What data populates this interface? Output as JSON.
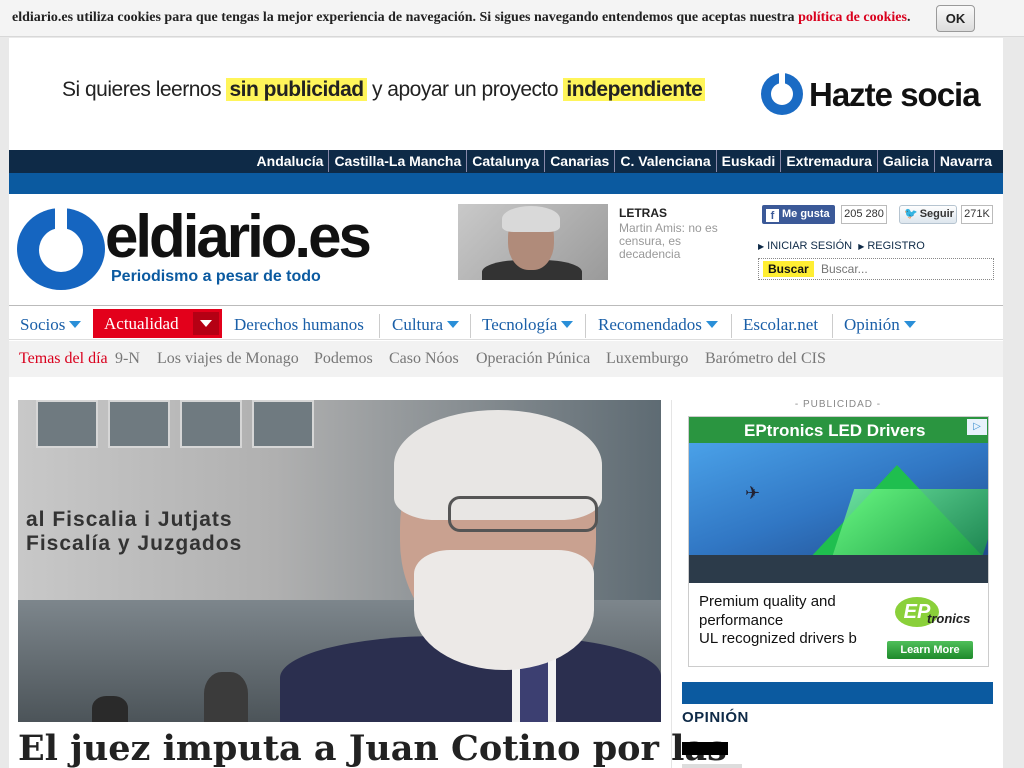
{
  "cookie": {
    "text": "eldiario.es utiliza cookies para que tengas la mejor experiencia de navegación. Si sigues navegando entendemos que aceptas nuestra ",
    "link": "política de cookies",
    "end": ".",
    "ok_label": "OK"
  },
  "promo": {
    "part1": "Si quieres leernos ",
    "hl1": "sin publicidad",
    "part2": " y apoyar un proyecto ",
    "hl2": "independiente",
    "cta": "Hazte socia"
  },
  "regions": [
    "Andalucía",
    "Castilla-La Mancha",
    "Catalunya",
    "Canarias",
    "C. Valenciana",
    "Euskadi",
    "Extremadura",
    "Galicia",
    "Navarra"
  ],
  "header": {
    "site_name": "eldiario.es",
    "tagline": "Periodismo a pesar de todo",
    "featured_section": "LETRAS",
    "featured_title": "Martin Amis: no es censura, es decadencia",
    "fb_label": "Me gusta",
    "fb_count": "205 280",
    "tw_label": "Seguir",
    "tw_count": "271K",
    "login": "INICIAR SESIÓN",
    "register": "REGISTRO",
    "search_button": "Buscar",
    "search_placeholder": "Buscar..."
  },
  "nav": {
    "socios": "Socios",
    "actualidad": "Actualidad",
    "derechos": "Derechos humanos",
    "cultura": "Cultura",
    "tecnologia": "Tecnología",
    "recomendados": "Recomendados",
    "escolar": "Escolar.net",
    "opinion": "Opinión"
  },
  "topics": {
    "lead": "Temas del día",
    "items": [
      "9-N",
      "Los viajes de Monago",
      "Podemos",
      "Caso Nóos",
      "Operación Púnica",
      "Luxemburgo",
      "Barómetro del CIS"
    ]
  },
  "hero": {
    "sign_line1": "al Fiscalia i Jutjats",
    "sign_line2": "Fiscalía y Juzgados",
    "headline": "El juez imputa a Juan Cotino por las"
  },
  "ad": {
    "label": "- PUBLICIDAD -",
    "title": "EPtronics LED Drivers",
    "adchoices": "▷",
    "copy1": "Premium quality and",
    "copy2": "performance",
    "copy3": "UL recognized drivers b",
    "logo_ep": "EP",
    "logo_text": "tronics",
    "cta": "Learn More"
  },
  "sidebar": {
    "opinion_title": "OPINIÓN"
  },
  "colors": {
    "brand_blue": "#0b5aa0",
    "navy": "#0e2a47",
    "accent_red": "#e3001b",
    "highlight_yellow": "#fff55a"
  }
}
